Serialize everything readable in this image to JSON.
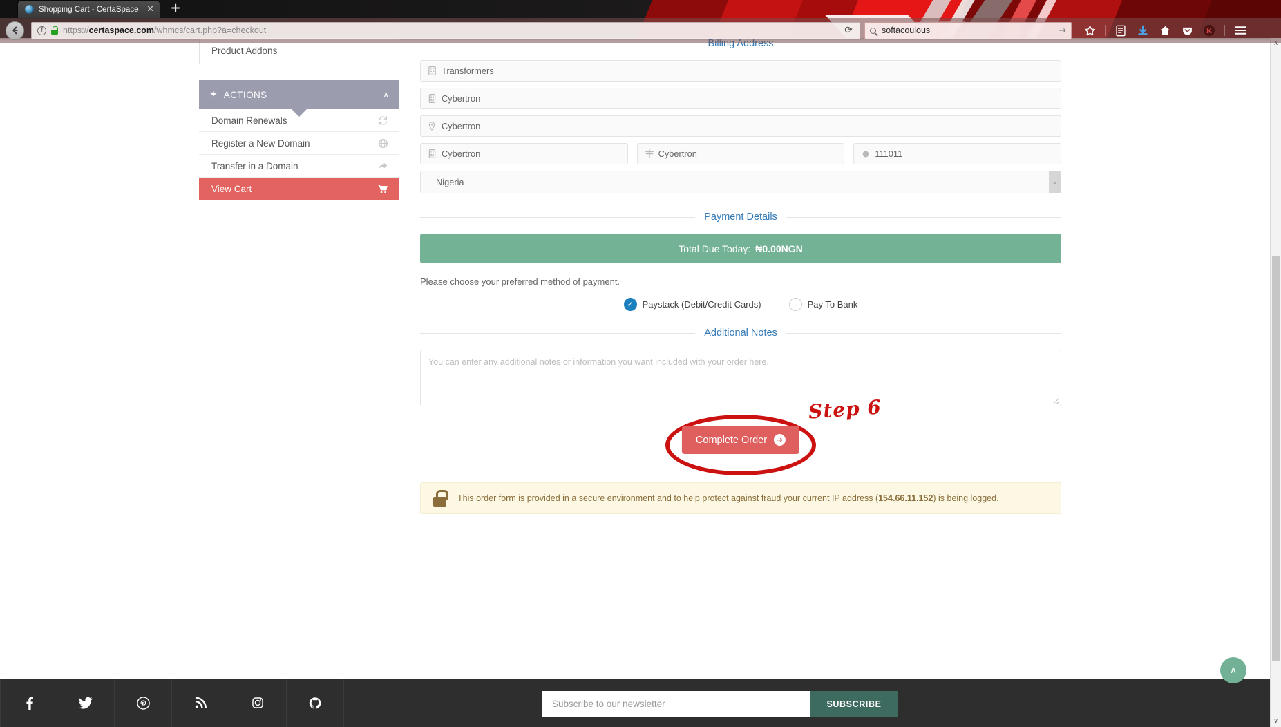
{
  "browser": {
    "tab": {
      "title": "Shopping Cart - CertaSpace",
      "close": "✕"
    },
    "new_tab": "+",
    "back": "←",
    "url_prefix": "https://",
    "url_host": "certaspace.com",
    "url_path": "/whmcs/cart.php?a=checkout",
    "reload": "⟳",
    "search_value": "softacoulous",
    "search_go": "→",
    "toolbar_icons": [
      "bookmark-star-icon",
      "library-icon",
      "downloads-icon",
      "home-icon",
      "pocket-icon",
      "user-avatar-icon",
      "hamburger-menu-icon"
    ],
    "avatar_letter": "K"
  },
  "sidebar": {
    "product_addons_label": "Product Addons",
    "actions": {
      "plus": "✦",
      "title": "ACTIONS",
      "collapse": "∧",
      "items": [
        {
          "label": "Domain Renewals",
          "icon": "refresh-icon",
          "active": false
        },
        {
          "label": "Register a New Domain",
          "icon": "globe-icon",
          "active": false
        },
        {
          "label": "Transfer in a Domain",
          "icon": "share-arrow-icon",
          "active": false
        },
        {
          "label": "View Cart",
          "icon": "shopping-cart-icon",
          "active": true
        }
      ]
    }
  },
  "billing": {
    "legend": "Billing Address",
    "company": {
      "value": "Transformers",
      "icon": "building-icon"
    },
    "address1": {
      "value": "Cybertron",
      "icon": "building-icon"
    },
    "address2": {
      "value": "Cybertron",
      "icon": "map-pin-icon"
    },
    "city": {
      "value": "Cybertron",
      "icon": "building-icon"
    },
    "state": {
      "value": "Cybertron",
      "icon": "signpost-icon"
    },
    "postcode": {
      "value": "111011",
      "icon": "circle-icon"
    },
    "country": {
      "value": "Nigeria",
      "arrow": "⌄"
    }
  },
  "payment": {
    "legend": "Payment Details",
    "total_label": "Total Due Today:",
    "total_amount": "₦0.00NGN",
    "choose_text": "Please choose your preferred method of payment.",
    "methods": [
      {
        "label": "Paystack (Debit/Credit Cards)",
        "selected": true
      },
      {
        "label": "Pay To Bank",
        "selected": false
      }
    ],
    "check_glyph": "✓"
  },
  "notes": {
    "legend": "Additional Notes",
    "placeholder": "You can enter any additional notes or information you want included with your order here.."
  },
  "cta": {
    "label": "Complete Order",
    "arrow": "➜",
    "annotation": "Step 6"
  },
  "secure": {
    "text_before": "This order form is provided in a secure environment and to help protect against fraud your current IP address (",
    "ip": "154.66.11.152",
    "text_after": ") is being logged."
  },
  "footer": {
    "social": [
      "facebook-icon",
      "twitter-icon",
      "pinterest-icon",
      "rss-icon",
      "instagram-icon",
      "github-icon"
    ],
    "newsletter_placeholder": "Subscribe to our newsletter",
    "subscribe_label": "SUBSCRIBE",
    "back_to_top": "∧"
  },
  "scrollbar": {
    "up": "∧",
    "down": "∨"
  },
  "colors": {
    "accent_red": "#de5f5d",
    "accent_green": "#73b295",
    "legend_blue": "#337ab7",
    "actions_header": "#9b9daf",
    "annotation_red": "#cc1111",
    "footer_bg": "#2e2e2e"
  }
}
